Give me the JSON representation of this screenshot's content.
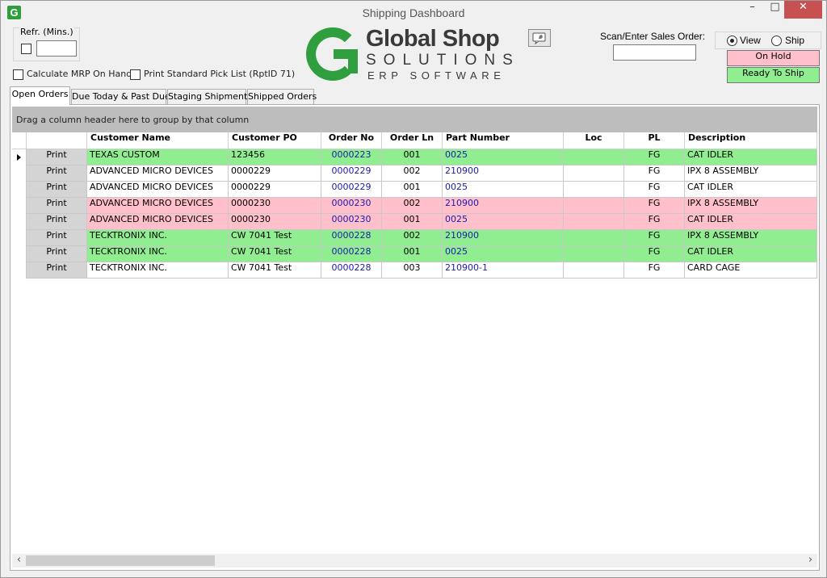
{
  "window": {
    "title": "Shipping Dashboard",
    "app_icon_letter": "G",
    "minimize": "–",
    "maximize": "□",
    "close": "✕"
  },
  "refresh": {
    "label": "Refr. (Mins.)",
    "checked": false,
    "value": ""
  },
  "options": {
    "calc_mrp_label": "Calculate MRP On Hand",
    "print_pick_label": "Print Standard Pick List (RptID 71)"
  },
  "logo": {
    "line1": "Global Shop",
    "line2": "SOLUTIONS",
    "line3": "ERP SOFTWARE"
  },
  "feedback_icon": "feedback-icon",
  "scan": {
    "label": "Scan/Enter Sales Order:",
    "value": ""
  },
  "mode": {
    "view_label": "View",
    "ship_label": "Ship",
    "selected": "View"
  },
  "legend": {
    "on_hold": "On Hold",
    "ready": "Ready To Ship",
    "on_hold_color": "#ffc0cb",
    "ready_color": "#90ee90"
  },
  "tabs": [
    {
      "label": "Open Orders",
      "active": true
    },
    {
      "label": "Due Today & Past Due",
      "active": false
    },
    {
      "label": "Staging Shipments",
      "active": false
    },
    {
      "label": "Shipped Orders",
      "active": false
    }
  ],
  "grid": {
    "group_hint": "Drag a column header here to group by that column",
    "columns": [
      "Customer Name",
      "Customer PO",
      "Order No",
      "Order Ln",
      "Part Number",
      "Loc",
      "PL",
      "Description"
    ],
    "print_label": "Print",
    "rows": [
      {
        "customer": "TEXAS CUSTOM",
        "po": "123456",
        "order_no": "0000223",
        "order_ln": "001",
        "part": "0025",
        "loc": "",
        "pl": "FG",
        "desc": "CAT IDLER",
        "status": "ready",
        "current": true
      },
      {
        "customer": "ADVANCED MICRO DEVICES",
        "po": "0000229",
        "order_no": "0000229",
        "order_ln": "002",
        "part": "210900",
        "loc": "",
        "pl": "FG",
        "desc": "IPX 8 ASSEMBLY",
        "status": "none",
        "current": false
      },
      {
        "customer": "ADVANCED MICRO DEVICES",
        "po": "0000229",
        "order_no": "0000229",
        "order_ln": "001",
        "part": "0025",
        "loc": "",
        "pl": "FG",
        "desc": "CAT IDLER",
        "status": "none",
        "current": false
      },
      {
        "customer": "ADVANCED MICRO DEVICES",
        "po": "0000230",
        "order_no": "0000230",
        "order_ln": "002",
        "part": "210900",
        "loc": "",
        "pl": "FG",
        "desc": "IPX 8 ASSEMBLY",
        "status": "hold",
        "current": false
      },
      {
        "customer": "ADVANCED MICRO DEVICES",
        "po": "0000230",
        "order_no": "0000230",
        "order_ln": "001",
        "part": "0025",
        "loc": "",
        "pl": "FG",
        "desc": "CAT IDLER",
        "status": "hold",
        "current": false
      },
      {
        "customer": "TECKTRONIX INC.",
        "po": "CW 7041 Test",
        "order_no": "0000228",
        "order_ln": "002",
        "part": "210900",
        "loc": "",
        "pl": "FG",
        "desc": "IPX 8 ASSEMBLY",
        "status": "ready",
        "current": false
      },
      {
        "customer": "TECKTRONIX INC.",
        "po": "CW 7041 Test",
        "order_no": "0000228",
        "order_ln": "001",
        "part": "0025",
        "loc": "",
        "pl": "FG",
        "desc": "CAT IDLER",
        "status": "ready",
        "current": false
      },
      {
        "customer": "TECKTRONIX INC.",
        "po": "CW 7041 Test",
        "order_no": "0000228",
        "order_ln": "003",
        "part": "210900-1",
        "loc": "",
        "pl": "FG",
        "desc": "CARD CAGE",
        "status": "none",
        "current": false
      }
    ]
  },
  "scroll": {
    "left_arrow": "‹",
    "right_arrow": "›"
  }
}
